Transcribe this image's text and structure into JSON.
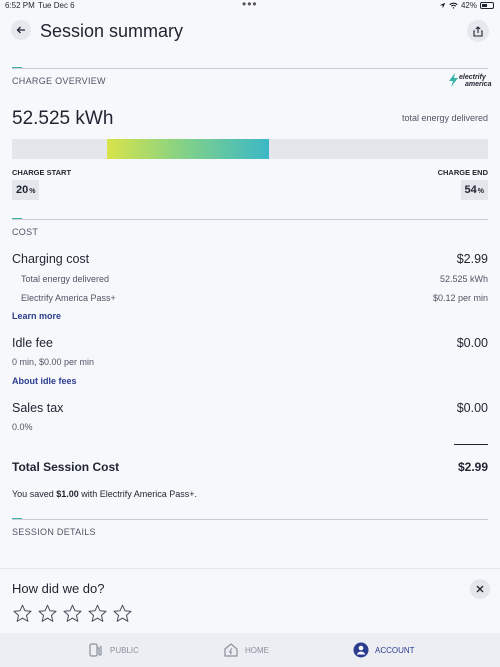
{
  "status_bar": {
    "time": "6:52 PM",
    "date": "Tue Dec 6",
    "battery": "42%"
  },
  "header": {
    "title": "Session summary"
  },
  "charge_overview": {
    "section_label": "CHARGE OVERVIEW",
    "logo_line1": "electrify",
    "logo_line2": "america",
    "energy_value": "52.525 kWh",
    "energy_label": "total energy delivered",
    "charge_start_label": "CHARGE START",
    "charge_start_value": "20",
    "charge_end_label": "CHARGE END",
    "charge_end_value": "54",
    "percent_sign": "%",
    "start_fraction": 0.2,
    "end_fraction": 0.54
  },
  "cost": {
    "section_label": "COST",
    "charging_cost_label": "Charging cost",
    "charging_cost_amount": "$2.99",
    "energy_delivered_label": "Total energy delivered",
    "energy_delivered_value": "52.525 kWh",
    "plan_label": "Electrify America Pass+",
    "plan_rate": "$0.12 per min",
    "learn_more": "Learn more",
    "idle_fee_label": "Idle fee",
    "idle_fee_amount": "$0.00",
    "idle_fee_detail": "0 min, $0.00 per min",
    "idle_fee_link": "About idle fees",
    "sales_tax_label": "Sales tax",
    "sales_tax_amount": "$0.00",
    "sales_tax_rate": "0.0%",
    "total_label": "Total Session Cost",
    "total_amount": "$2.99",
    "saved_prefix": "You saved ",
    "saved_amount": "$1.00",
    "saved_suffix": " with Electrify America Pass+."
  },
  "session_details": {
    "section_label": "SESSION DETAILS"
  },
  "feedback": {
    "title": "How did we do?",
    "star_count": 5,
    "rating": 0
  },
  "tabs": [
    {
      "label": "PUBLIC",
      "icon": "charger-icon"
    },
    {
      "label": "HOME",
      "icon": "home-icon"
    },
    {
      "label": "ACCOUNT",
      "icon": "account-icon"
    }
  ],
  "colors": {
    "accent": "#39b3a8",
    "link": "#2c3d8f",
    "gradient_start": "#d8e34a",
    "gradient_end": "#3bb8c6"
  }
}
